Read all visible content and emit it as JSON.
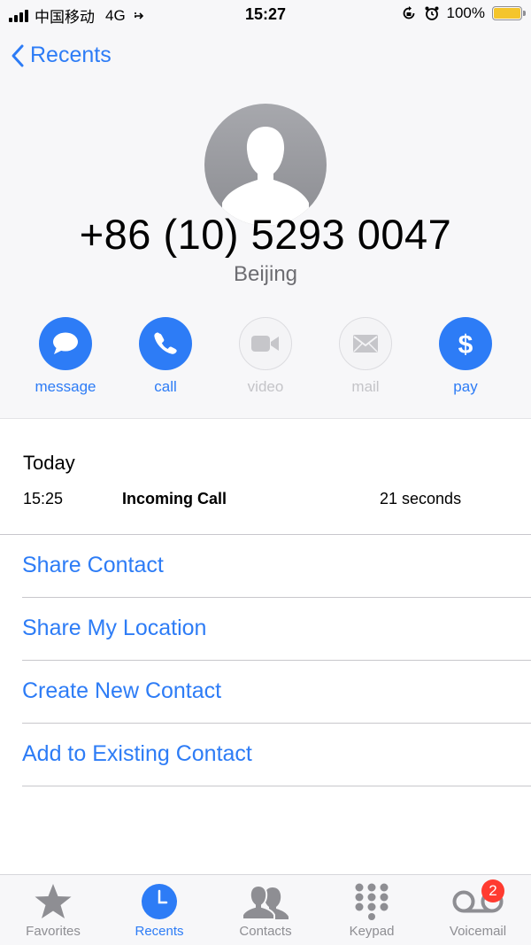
{
  "status_bar": {
    "carrier": "中国移动",
    "network": "4G",
    "time": "15:27",
    "battery": "100%",
    "battery_level": 1.0
  },
  "nav": {
    "back_label": "Recents"
  },
  "contact": {
    "number": "+86 (10) 5293 0047",
    "location": "Beijing"
  },
  "actions": [
    {
      "label": "message",
      "icon": "message-icon",
      "enabled": true
    },
    {
      "label": "call",
      "icon": "phone-icon",
      "enabled": true
    },
    {
      "label": "video",
      "icon": "video-icon",
      "enabled": false
    },
    {
      "label": "mail",
      "icon": "mail-icon",
      "enabled": false
    },
    {
      "label": "pay",
      "icon": "dollar-icon",
      "enabled": true
    }
  ],
  "recent": {
    "day": "Today",
    "time": "15:25",
    "type": "Incoming Call",
    "duration": "21 seconds"
  },
  "options": [
    "Share Contact",
    "Share My Location",
    "Create New Contact",
    "Add to Existing Contact"
  ],
  "tabs": [
    {
      "label": "Favorites",
      "icon": "star-icon"
    },
    {
      "label": "Recents",
      "icon": "clock-icon",
      "active": true
    },
    {
      "label": "Contacts",
      "icon": "contacts-icon"
    },
    {
      "label": "Keypad",
      "icon": "keypad-icon"
    },
    {
      "label": "Voicemail",
      "icon": "voicemail-icon",
      "badge": "2"
    }
  ],
  "colors": {
    "accent": "#2d7cf6",
    "badge": "#ff3b30",
    "battery": "#f4c52c"
  }
}
